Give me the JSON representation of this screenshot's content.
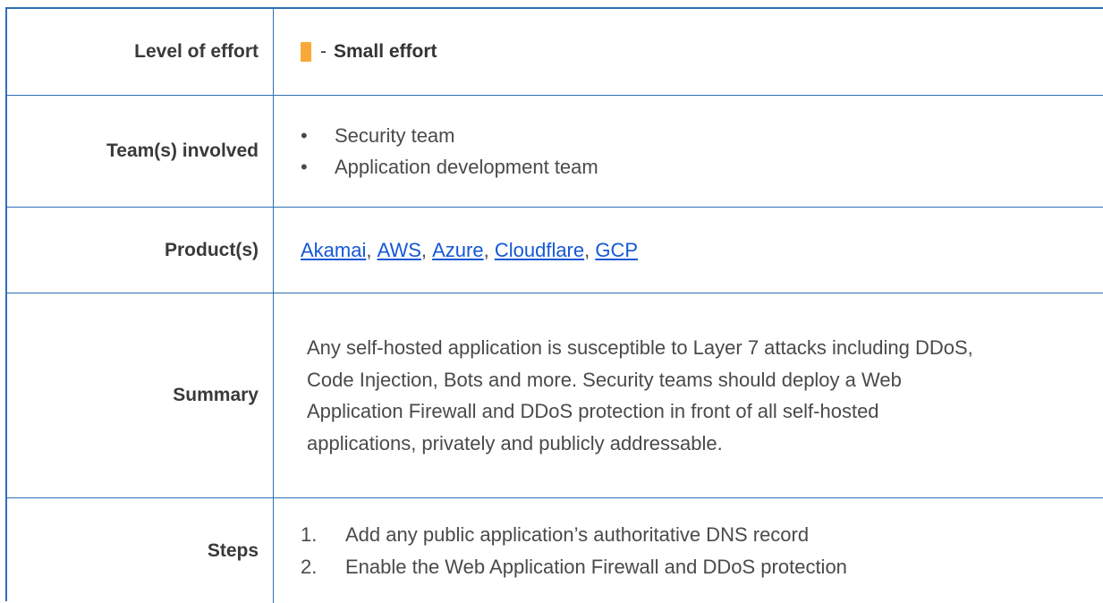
{
  "rows": {
    "effort": {
      "label": "Level of effort",
      "dash": "-",
      "value": "Small effort"
    },
    "teams": {
      "label": "Team(s) involved",
      "items": [
        "Security team",
        "Application development team"
      ]
    },
    "products": {
      "label": "Product(s)",
      "links": [
        "Akamai",
        "AWS",
        "Azure",
        "Cloudflare",
        "GCP"
      ],
      "separator": ", "
    },
    "summary": {
      "label": "Summary",
      "text": "Any self-hosted application is susceptible to Layer 7 attacks including DDoS, Code Injection, Bots and more. Security teams should deploy a Web Application Firewall and DDoS protection in front of all self-hosted applications, privately and publicly addressable."
    },
    "steps": {
      "label": "Steps",
      "items": [
        {
          "num": "1.",
          "text": "Add any public application’s authoritative DNS record"
        },
        {
          "num": "2.",
          "text": "Enable the Web Application Firewall and DDoS protection"
        }
      ]
    }
  },
  "colors": {
    "border": "#2f6fb5",
    "effort_bar": "#f9a93a",
    "link": "#1558d6"
  }
}
